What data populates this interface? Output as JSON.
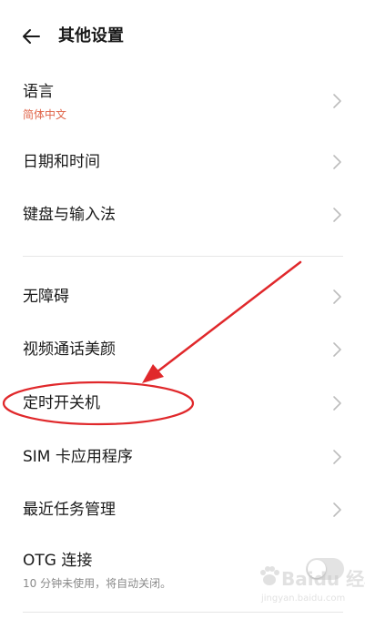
{
  "header": {
    "title": "其他设置",
    "back_icon": "back-arrow-icon"
  },
  "colors": {
    "subtitle_accent": "#e0654a",
    "subtitle_gray": "#8a8a8a",
    "annotation_red": "#e0282b"
  },
  "settings": [
    {
      "label": "语言",
      "subtitle": "简体中文"
    },
    {
      "label": "日期和时间"
    },
    {
      "label": "键盘与输入法"
    },
    {
      "label": "无障碍"
    },
    {
      "label": "视频通话美颜"
    },
    {
      "label": "定时开关机"
    },
    {
      "label": "SIM 卡应用程序"
    },
    {
      "label": "最近任务管理"
    },
    {
      "label": "OTG 连接",
      "subtitle": "10 分钟未使用，将自动关闭。",
      "toggle_on": false
    }
  ],
  "watermark": {
    "text": "Baidu 经验",
    "url": "jingyan.baidu.com"
  }
}
